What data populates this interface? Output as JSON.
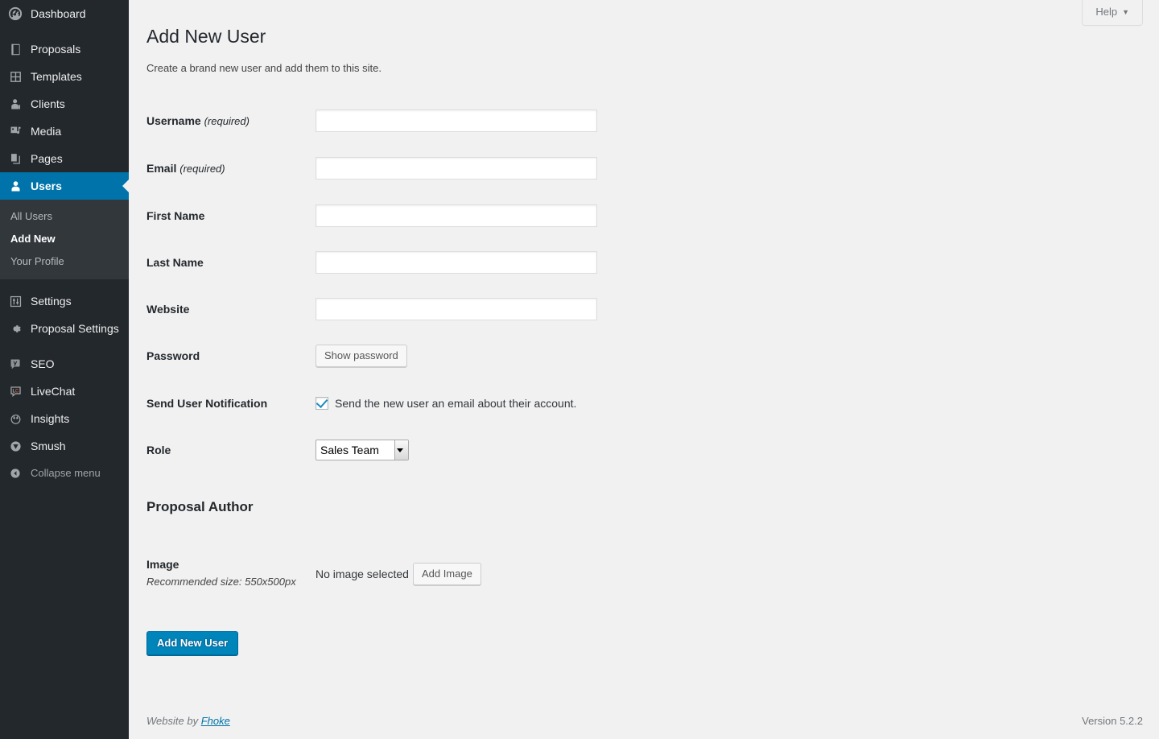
{
  "sidebar": {
    "items": [
      {
        "label": "Dashboard",
        "icon": "dashboard-gauge-icon",
        "name": "dashboard"
      },
      {
        "label": "Proposals",
        "icon": "book-icon",
        "name": "proposals"
      },
      {
        "label": "Templates",
        "icon": "grid-icon",
        "name": "templates"
      },
      {
        "label": "Clients",
        "icon": "person-business-icon",
        "name": "clients"
      },
      {
        "label": "Media",
        "icon": "media-icon",
        "name": "media"
      },
      {
        "label": "Pages",
        "icon": "pages-icon",
        "name": "pages"
      },
      {
        "label": "Users",
        "icon": "user-icon",
        "name": "users",
        "current": true
      }
    ],
    "submenu": [
      {
        "label": "All Users",
        "name": "all-users"
      },
      {
        "label": "Add New",
        "name": "add-new",
        "current": true
      },
      {
        "label": "Your Profile",
        "name": "your-profile"
      }
    ],
    "items_after": [
      {
        "label": "Settings",
        "icon": "sliders-icon",
        "name": "settings"
      },
      {
        "label": "Proposal Settings",
        "icon": "gear-icon",
        "name": "proposal-settings"
      }
    ],
    "plugins": [
      {
        "label": "SEO",
        "icon": "yoast-seo-icon",
        "name": "seo"
      },
      {
        "label": "LiveChat",
        "icon": "livechat-icon",
        "name": "livechat"
      },
      {
        "label": "Insights",
        "icon": "monsterinsights-icon",
        "name": "insights"
      },
      {
        "label": "Smush",
        "icon": "smush-icon",
        "name": "smush"
      }
    ],
    "collapse": {
      "label": "Collapse menu",
      "icon": "collapse-arrow-icon"
    },
    "accent_color": "#0073aa",
    "background_color": "#23282d",
    "submenu_background_color": "#32373c"
  },
  "screen_meta": {
    "help_label": "Help",
    "help_caret": "▼"
  },
  "main": {
    "title": "Add New User",
    "subtitle": "Create a brand new user and add them to this site.",
    "fields": [
      {
        "label": "Username",
        "required_note": "(required)",
        "name": "username",
        "value": "",
        "placeholder": ""
      },
      {
        "label": "Email",
        "required_note": "(required)",
        "name": "email",
        "value": "",
        "placeholder": ""
      },
      {
        "label": "First Name",
        "required_note": "",
        "name": "first-name",
        "value": "",
        "placeholder": ""
      },
      {
        "label": "Last Name",
        "required_note": "",
        "name": "last-name",
        "value": "",
        "placeholder": ""
      },
      {
        "label": "Website",
        "required_note": "",
        "name": "website",
        "value": "",
        "placeholder": ""
      }
    ],
    "password": {
      "label": "Password",
      "button_label": "Show password"
    },
    "notification": {
      "label": "Send User Notification",
      "checkbox_label": "Send the new user an email about their account.",
      "checked": true
    },
    "role": {
      "label": "Role",
      "selected": "Sales Team",
      "options": [
        "Sales Team"
      ]
    },
    "proposal_author": {
      "section_title": "Proposal Author",
      "image_label": "Image",
      "image_help": "Recommended size: 550x500px",
      "no_image_text": "No image selected",
      "add_image_label": "Add Image"
    },
    "submit_label": "Add New User",
    "primary_color": "#0085ba"
  },
  "footer": {
    "left_prefix": "Website by ",
    "left_link": "Fhoke",
    "right": "Version 5.2.2"
  }
}
